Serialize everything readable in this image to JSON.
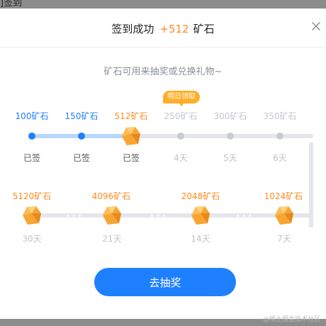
{
  "background": {
    "corner_text": "]签到"
  },
  "modal": {
    "title_prefix": "签到成功",
    "title_amount": "+512",
    "title_suffix": "矿石",
    "subtitle": "矿石可用来抽奖或兑换礼物~",
    "tomorrow_badge": "明日领取",
    "cta_label": "去抽奖"
  },
  "top_row": [
    {
      "amount": "100矿石",
      "day": "已签",
      "state": "done"
    },
    {
      "amount": "150矿石",
      "day": "已签",
      "state": "done"
    },
    {
      "amount": "512矿石",
      "day": "已签",
      "state": "today"
    },
    {
      "amount": "250矿石",
      "day": "4天",
      "state": "todo"
    },
    {
      "amount": "300矿石",
      "day": "5天",
      "state": "todo"
    },
    {
      "amount": "350矿石",
      "day": "6天",
      "state": "todo"
    }
  ],
  "bottom_row": [
    {
      "amount": "5120矿石",
      "day": "30天"
    },
    {
      "amount": "4096矿石",
      "day": "21天"
    },
    {
      "amount": "2048矿石",
      "day": "14天"
    },
    {
      "amount": "1024矿石",
      "day": "7天"
    }
  ],
  "watermark": "@稀土掘金技术社区",
  "colors": {
    "accent": "#1e80ff",
    "reward": "#ff8a1f",
    "badge": "#ffae28",
    "muted": "#c2c6cc"
  },
  "icons": {
    "close": "close-icon",
    "ore": "ore-icon"
  }
}
